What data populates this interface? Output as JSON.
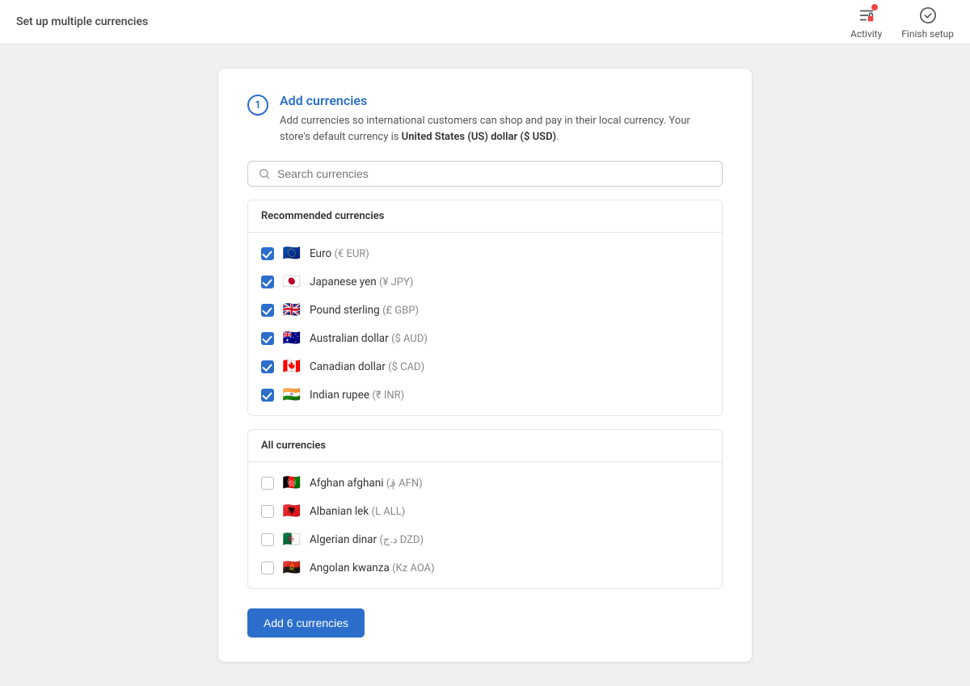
{
  "topbar": {
    "title": "Set up multiple currencies",
    "activity_label": "Activity",
    "finish_label": "Finish setup"
  },
  "card": {
    "step": "1",
    "heading": "Add currencies",
    "description_part1": "Add currencies so international customers can shop and pay in their local currency. Your store's default currency is ",
    "default_currency": "United States (US) dollar ($ USD)",
    "description_part2": ".",
    "search_placeholder": "Search currencies"
  },
  "recommended_section": {
    "label": "Recommended currencies",
    "items": [
      {
        "flag": "🇪🇺",
        "name": "Euro",
        "code": "(€ EUR)",
        "checked": true
      },
      {
        "flag": "🇯🇵",
        "name": "Japanese yen",
        "code": "(¥ JPY)",
        "checked": true
      },
      {
        "flag": "🇬🇧",
        "name": "Pound sterling",
        "code": "(£ GBP)",
        "checked": true
      },
      {
        "flag": "🇦🇺",
        "name": "Australian dollar",
        "code": "($ AUD)",
        "checked": true
      },
      {
        "flag": "🇨🇦",
        "name": "Canadian dollar",
        "code": "($ CAD)",
        "checked": true
      },
      {
        "flag": "🇮🇳",
        "name": "Indian rupee",
        "code": "(₹ INR)",
        "checked": true
      }
    ]
  },
  "all_section": {
    "label": "All currencies",
    "items": [
      {
        "flag": "🇦🇫",
        "name": "Afghan afghani",
        "code": "(؋ AFN)",
        "checked": false
      },
      {
        "flag": "🇦🇱",
        "name": "Albanian lek",
        "code": "(L ALL)",
        "checked": false
      },
      {
        "flag": "🇩🇿",
        "name": "Algerian dinar",
        "code": "(د.ج DZD)",
        "checked": false
      },
      {
        "flag": "🇦🇴",
        "name": "Angolan kwanza",
        "code": "(Kz AOA)",
        "checked": false
      }
    ]
  },
  "add_button": {
    "label": "Add 6 currencies"
  }
}
